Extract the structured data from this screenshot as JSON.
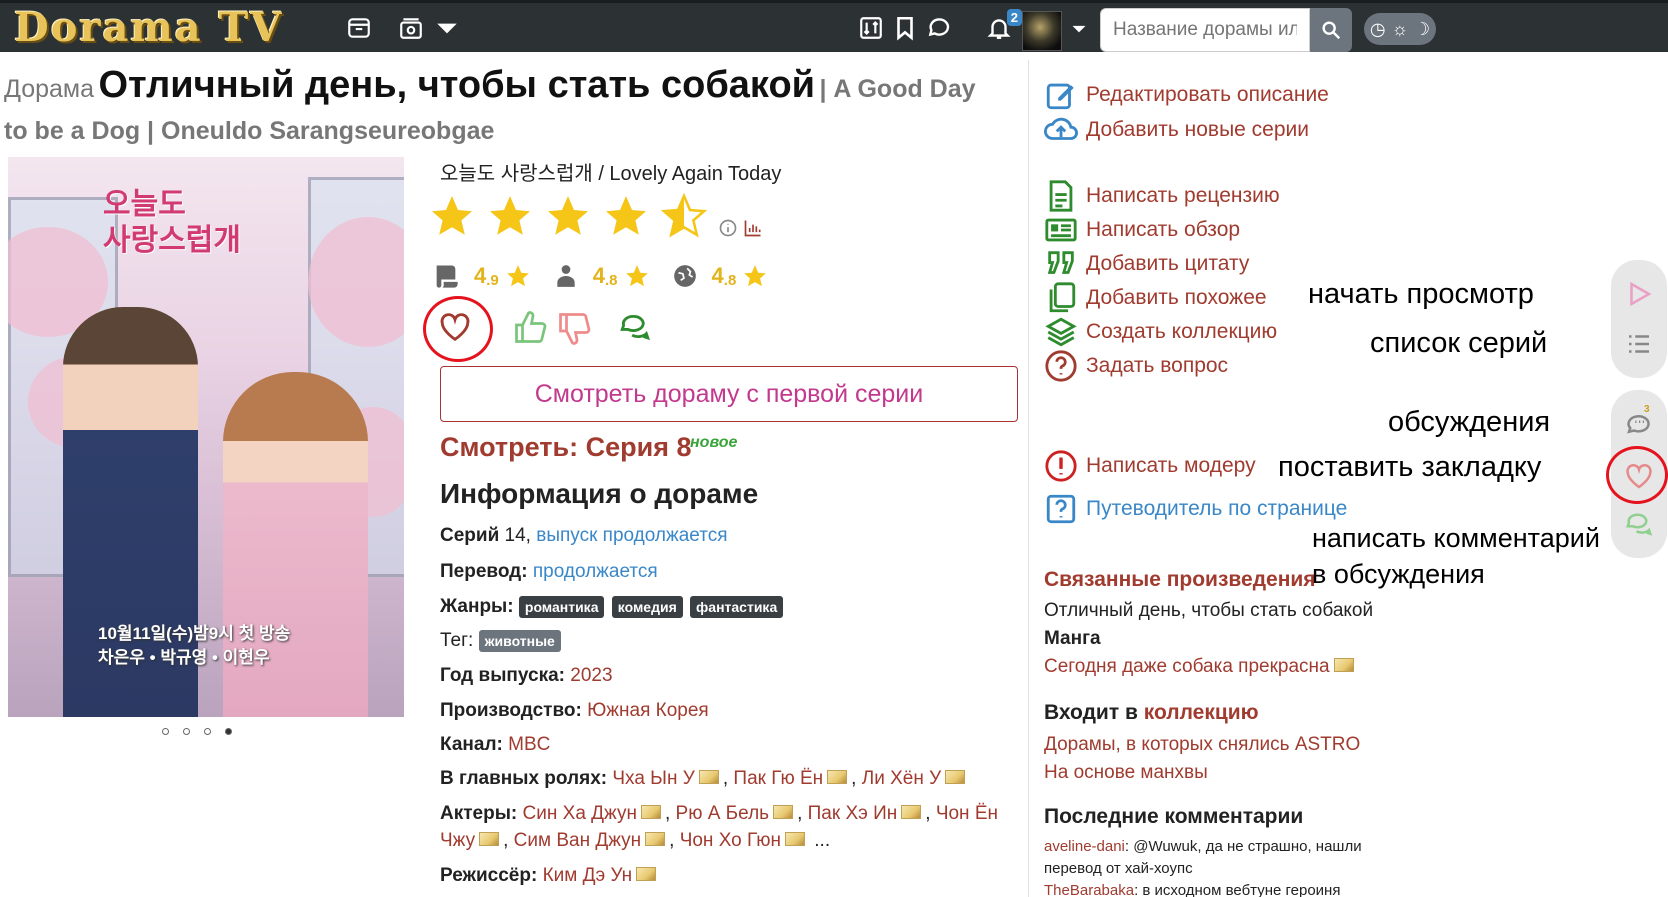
{
  "navbar": {
    "logo": "Dorama TV",
    "notifications_count": "2",
    "search_placeholder": "Название дорамы или актера"
  },
  "title": {
    "prefix": "Дорама",
    "main": "Отличный день, чтобы стать собакой",
    "alt": "| A Good Day to be a Dog | Oneuldo Sarangseureobgae"
  },
  "poster": {
    "title_line1": "오늘도",
    "title_line2": "사랑스럽개",
    "bottom_line1": "10월11일(수)밤9시 첫 방송",
    "bottom_line2": "차은우 • 박규영 • 이현우",
    "slides": 4,
    "active_slide": 4
  },
  "subtitle": "오늘도 사랑스럽개 / Lovely Again Today",
  "rating": {
    "stars": 4.5,
    "max": 5,
    "sub_ratings": [
      {
        "icon": "scroll-icon",
        "value": "4",
        "decimal": ".9"
      },
      {
        "icon": "person-icon",
        "value": "4",
        "decimal": ".8"
      },
      {
        "icon": "globe-icon",
        "value": "4",
        "decimal": ".8"
      }
    ]
  },
  "watch_button": "Смотреть дораму с первой серии",
  "watch_episode": "Смотреть: Серия 8",
  "badge_new": "новое",
  "info_title": "Информация о дораме",
  "info": {
    "episodes_label": "Серий",
    "episodes_value": "14,",
    "episodes_status": "выпуск продолжается",
    "translation_label": "Перевод:",
    "translation_value": "продолжается",
    "genres_label": "Жанры:",
    "genres": [
      "романтика",
      "комедия",
      "фантастика"
    ],
    "tag_label": "Тег:",
    "tag": "животные",
    "year_label": "Год выпуска:",
    "year": "2023",
    "production_label": "Производство:",
    "production": "Южная Корея",
    "channel_label": "Канал:",
    "channel": "MBC",
    "main_roles_label": "В главных ролях:",
    "main_roles": [
      "Чха Ын У",
      "Пак Гю Ён",
      "Ли Хён У"
    ],
    "actors_label": "Актеры:",
    "actors_line1": [
      "Син Ха Джун",
      "Рю А Бель",
      "Пак Хэ Ин",
      "Чон Ён"
    ],
    "actors_line2": [
      "Чжу",
      "Сим Ван Джун",
      "Чон Хо Гюн"
    ],
    "actors_more": "...",
    "director_label": "Режиссёр:",
    "director": "Ким Дэ Ун"
  },
  "sidebar": {
    "edit": "Редактировать описание",
    "add_episodes": "Добавить новые серии",
    "write_review": "Написать рецензию",
    "write_overview": "Написать обзор",
    "add_quote": "Добавить цитату",
    "add_similar": "Добавить похожее",
    "create_collection": "Создать коллекцию",
    "ask_question": "Задать вопрос",
    "write_mod": "Написать модеру",
    "guide": "Путеводитель по странице",
    "related_title": "Связанные произведения",
    "related_item": "Отличный день, чтобы стать собакой",
    "manga_label": "Манга",
    "manga_item": "Сегодня даже собака прекрасна",
    "collection_prefix": "Входит в",
    "collection_word": "коллекцию",
    "collection_items": [
      "Дорамы, в которых снялись ASTRO",
      "На основе манхвы"
    ],
    "comments_title": "Последние комментарии",
    "comments": [
      {
        "user": "aveline-dani",
        "text": ": @Wuwuk, да не страшно, нашли перевод от хай-хоупс"
      },
      {
        "user": "TheBarabaka",
        "text": ": в исходном вебтуне героиня"
      }
    ]
  },
  "annotations": {
    "start_watching": "начать просмотр",
    "episode_list": "список серий",
    "discussions": "обсуждения",
    "bookmark": "поставить закладку",
    "comment_line1": "написать комментарий",
    "comment_line2": "в обсуждения"
  },
  "float_panel": {
    "discussion_count": "3"
  },
  "colors": {
    "navbar": "#2c3134",
    "accent_red": "#a03b2f",
    "link_blue": "#3a87c8",
    "green": "#2e8b2e",
    "star": "#f5c518",
    "annotation_circle": "#e5131e"
  }
}
